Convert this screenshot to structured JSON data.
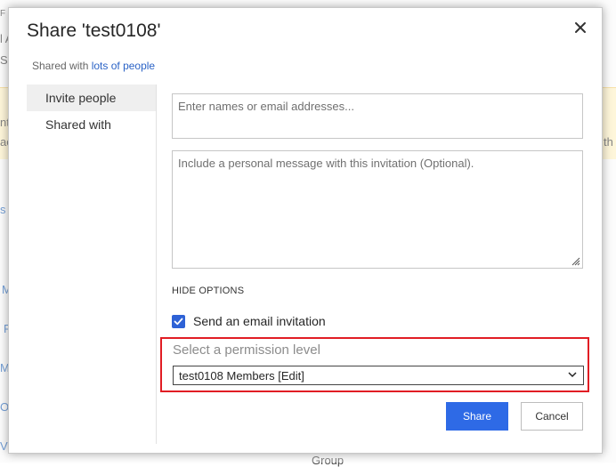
{
  "background": {
    "fragments": [
      "F",
      "l A",
      "S",
      "nt",
      "ac",
      "th",
      "s",
      "M",
      "F",
      "M",
      "O",
      "Vi",
      "Group"
    ]
  },
  "dialog": {
    "title": "Share 'test0108'",
    "close_glyph": "✕",
    "shared_with_prefix": "Shared with",
    "shared_with_link": "lots of people",
    "nav": {
      "items": [
        {
          "label": "Invite people",
          "active": true
        },
        {
          "label": "Shared with",
          "active": false
        }
      ]
    },
    "names_input": {
      "placeholder": "Enter names or email addresses...",
      "value": ""
    },
    "message_input": {
      "placeholder": "Include a personal message with this invitation (Optional).",
      "value": ""
    },
    "hide_options": "HIDE OPTIONS",
    "email_invitation": {
      "label": "Send an email invitation",
      "checked": true
    },
    "permission": {
      "label": "Select a permission level",
      "selected": "test0108 Members [Edit]"
    },
    "buttons": {
      "share": "Share",
      "cancel": "Cancel"
    }
  },
  "colors": {
    "accent": "#2e6ae6",
    "highlight_border": "#e11d24",
    "link": "#2b63c6"
  },
  "icons": [
    "close-icon",
    "checkmark-icon",
    "chevron-down-icon",
    "resize-grip-icon"
  ]
}
